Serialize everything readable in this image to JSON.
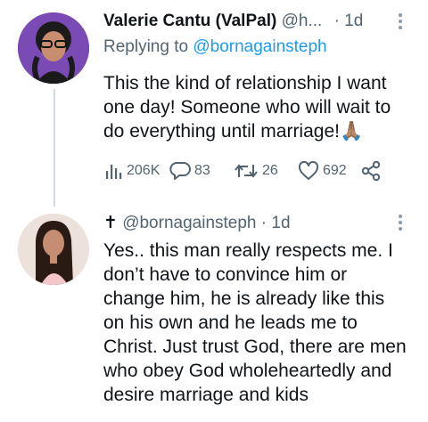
{
  "tweet1": {
    "display_name": "Valerie Cantu (ValPal)",
    "handle": "@h...",
    "time": "· 1d",
    "replying_prefix": "Replying to",
    "replying_handle": "@bornagainsteph",
    "text": "This the kind of relationship I want one day! Someone who will wait to do everything until marriage!🙏🏽",
    "text_lines": [
      "This the kind of relationship I want",
      "one day! Someone who will wait to",
      "do everything until marriage!🙏🏽"
    ],
    "stats": {
      "views": "206K",
      "replies": "83",
      "retweets": "26",
      "likes": "692"
    }
  },
  "tweet2": {
    "cross_glyph": "✝",
    "handle": "@bornagainsteph",
    "time": "· 1d",
    "text_lines": [
      "Yes.. this man really respects me. I",
      "don’t have to convince him or",
      "change him, he is already like this",
      "on his own and he leads me to",
      "Christ. Just trust God, there are men",
      "who obey God wholeheartedly and",
      "desire marriage and kids"
    ]
  },
  "colors": {
    "text": "#0f1419",
    "muted": "#536471",
    "link": "#1d9bf0",
    "thread_line": "#cfd9de",
    "avatar1_bg": "#6a3fa0"
  }
}
